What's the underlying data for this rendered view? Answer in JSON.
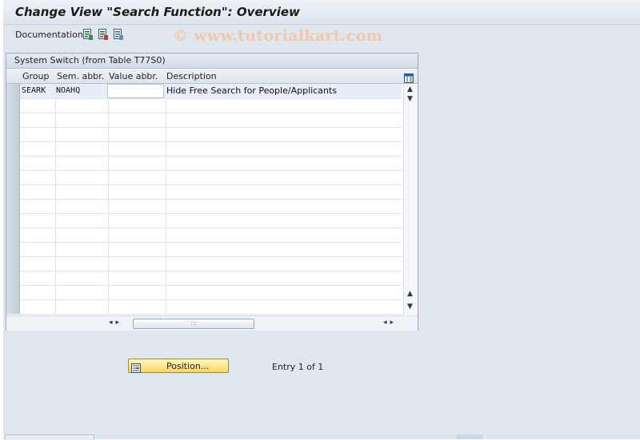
{
  "window": {
    "title": "Change View \"Search Function\": Overview"
  },
  "toolbar": {
    "documentation_label": "Documentation",
    "icons": [
      "detail-icon",
      "bc-set-icon",
      "print-icon"
    ]
  },
  "watermark": "© www.tutorialkart.com",
  "table": {
    "caption": "System Switch (from Table T77S0)",
    "columns": [
      "Group",
      "Sem. abbr.",
      "Value abbr.",
      "Description"
    ],
    "rows": [
      {
        "group": "SEARK",
        "sem_abbr": "NOAHQ",
        "value_abbr": "",
        "description": "Hide Free Search for People/Applicants"
      }
    ],
    "total_visible_rows": 16
  },
  "position_button": {
    "label": "Position..."
  },
  "entry_info": "Entry 1 of 1",
  "colors": {
    "background": "#dfe6ee",
    "button": "#f8d860",
    "accent": "#1f5f9f"
  }
}
